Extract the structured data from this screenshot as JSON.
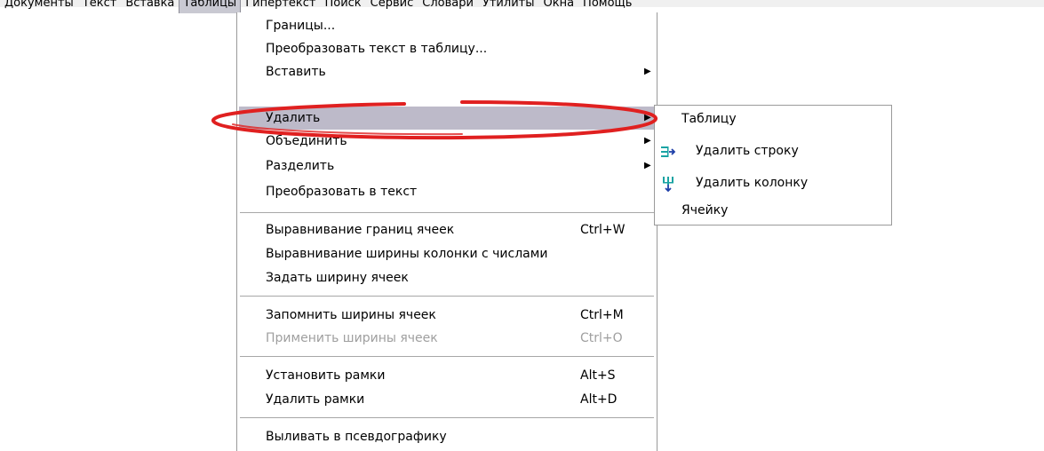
{
  "menubar": {
    "items": [
      "Документы",
      "Текст",
      "Вставка",
      "Таблицы",
      "Гипертекст",
      "Поиск",
      "Сервис",
      "Словари",
      "Утилиты",
      "Окна",
      "Помощь"
    ],
    "active": "Таблицы"
  },
  "tables_menu": {
    "items": [
      {
        "label": "Границы..."
      },
      {
        "label": "Преобразовать текст в таблицу..."
      },
      {
        "label": "Вставить",
        "has_submenu": true
      },
      {
        "label": "Удалить",
        "has_submenu": true,
        "highlighted": true
      },
      {
        "label": "Объединить",
        "has_submenu": true
      },
      {
        "label": "Разделить",
        "has_submenu": true
      },
      {
        "label": "Преобразовать в текст"
      },
      {
        "label": "Выравнивание границ ячеек",
        "shortcut": "Ctrl+W"
      },
      {
        "label": "Выравнивание ширины колонки с числами"
      },
      {
        "label": "Задать ширину ячеек"
      },
      {
        "label": "Запомнить ширины ячеек",
        "shortcut": "Ctrl+M"
      },
      {
        "label": "Применить ширины ячеек",
        "shortcut": "Ctrl+O",
        "disabled": true
      },
      {
        "label": "Установить рамки",
        "shortcut": "Alt+S"
      },
      {
        "label": "Удалить рамки",
        "shortcut": "Alt+D"
      },
      {
        "label": "Выливать в псевдографику"
      }
    ]
  },
  "delete_submenu": {
    "items": [
      {
        "label": "Таблицу"
      },
      {
        "label": "Удалить строку",
        "icon": "delete-row-icon"
      },
      {
        "label": "Удалить колонку",
        "icon": "delete-column-icon"
      },
      {
        "label": "Ячейку"
      }
    ]
  },
  "colors": {
    "highlight": "#bdbac9",
    "annotation": "#e02020",
    "icon_teal": "#1aa3a3",
    "icon_blue": "#1e3fa8"
  }
}
